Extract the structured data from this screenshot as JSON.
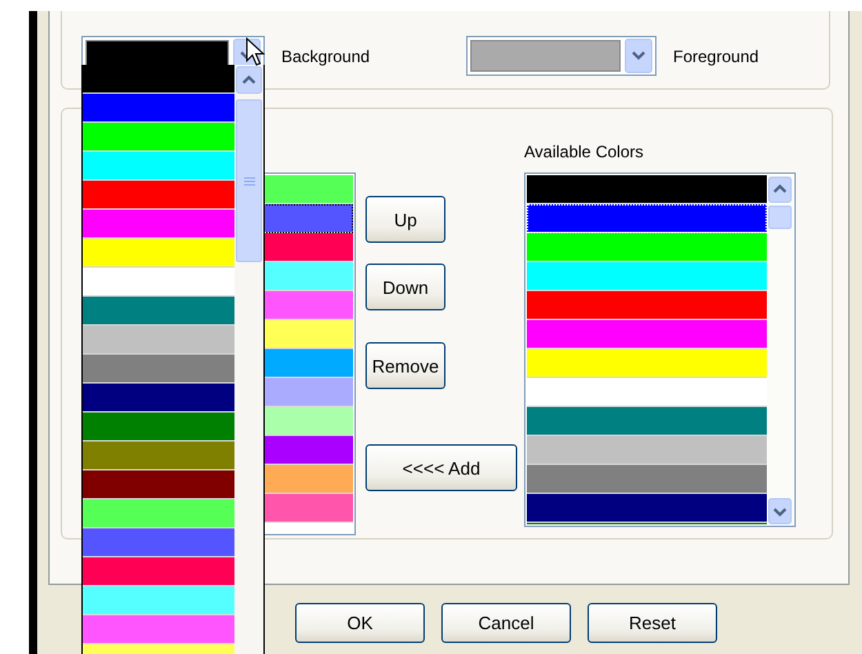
{
  "background": {
    "label": "Background",
    "color": "#000000",
    "open": true
  },
  "foreground": {
    "label": "Foreground",
    "color": "#aaaaaa"
  },
  "dropdown_options": [
    {
      "color": "#000000"
    },
    {
      "color": "#0000ff"
    },
    {
      "color": "#00ff00"
    },
    {
      "color": "#00ffff"
    },
    {
      "color": "#ff0000"
    },
    {
      "color": "#ff00ff"
    },
    {
      "color": "#ffff00"
    },
    {
      "color": "#ffffff"
    },
    {
      "color": "#008080"
    },
    {
      "color": "#c0c0c0"
    },
    {
      "color": "#808080"
    },
    {
      "color": "#000080"
    },
    {
      "color": "#008000"
    },
    {
      "color": "#808000"
    },
    {
      "color": "#800000"
    },
    {
      "color": "#55ff55"
    },
    {
      "color": "#5555ff"
    },
    {
      "color": "#ff0055"
    },
    {
      "color": "#55ffff"
    },
    {
      "color": "#ff55ff"
    },
    {
      "color": "#ffff55"
    }
  ],
  "selected_colors": [
    {
      "color": "#55ff55",
      "focused": false
    },
    {
      "color": "#5555ff",
      "focused": true
    },
    {
      "color": "#ff0055",
      "focused": false
    },
    {
      "color": "#55ffff",
      "focused": false
    },
    {
      "color": "#ff55ff",
      "focused": false
    },
    {
      "color": "#ffff55",
      "focused": false
    },
    {
      "color": "#00aaff",
      "focused": false
    },
    {
      "color": "#aaaaff",
      "focused": false
    },
    {
      "color": "#aaffaa",
      "focused": false
    },
    {
      "color": "#aa00ff",
      "focused": false
    },
    {
      "color": "#ffaa55",
      "focused": false
    },
    {
      "color": "#ff55aa",
      "focused": false
    }
  ],
  "list_buttons": [
    "Up",
    "Down",
    "Remove",
    "<<<< Add"
  ],
  "available": {
    "label": "Available Colors",
    "items": [
      {
        "color": "#000000",
        "focused": false
      },
      {
        "color": "#0000ff",
        "focused": true
      },
      {
        "color": "#00ff00",
        "focused": false
      },
      {
        "color": "#00ffff",
        "focused": false
      },
      {
        "color": "#ff0000",
        "focused": false
      },
      {
        "color": "#ff00ff",
        "focused": false
      },
      {
        "color": "#ffff00",
        "focused": false
      },
      {
        "color": "#ffffff",
        "focused": false
      },
      {
        "color": "#008080",
        "focused": false
      },
      {
        "color": "#c0c0c0",
        "focused": false
      },
      {
        "color": "#808080",
        "focused": false
      },
      {
        "color": "#000080",
        "focused": false
      },
      {
        "color": "#008000",
        "focused": false
      }
    ]
  },
  "dialog_buttons": [
    "OK",
    "Cancel",
    "Reset"
  ]
}
